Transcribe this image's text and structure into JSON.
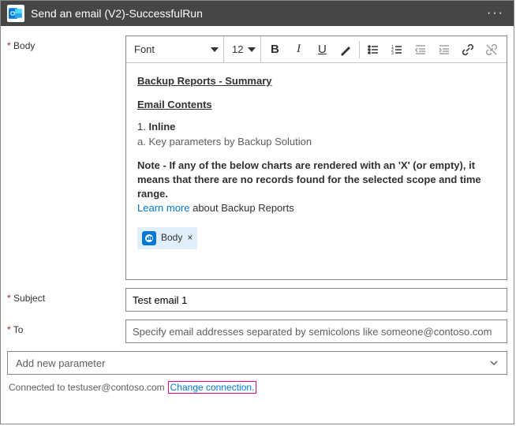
{
  "header": {
    "title": "Send an email (V2)-SuccessfulRun"
  },
  "labels": {
    "body": "Body",
    "subject": "Subject",
    "to": "To"
  },
  "toolbar": {
    "font": "Font",
    "size": "12"
  },
  "body_content": {
    "title_part1": "Backup Reports",
    "title_part2": " - Summary",
    "subheading": "Email Contents",
    "item1_num": "1. ",
    "item1_text": "Inline",
    "item1a": "a. Key parameters by Backup Solution",
    "note_label": "Note",
    "note_text": " - If any of the below charts are rendered with an 'X' (or empty), it means that there are no records found for the selected scope and time range.",
    "learn_link": "Learn more",
    "learn_rest": " about Backup Reports",
    "chip_label": "Body"
  },
  "subject_value": "Test email 1",
  "to_placeholder": "Specify email addresses separated by semicolons like someone@contoso.com",
  "param_placeholder": "Add new parameter",
  "footer": {
    "connected_to": "Connected to testuser@contoso.com",
    "change": "Change connection."
  }
}
